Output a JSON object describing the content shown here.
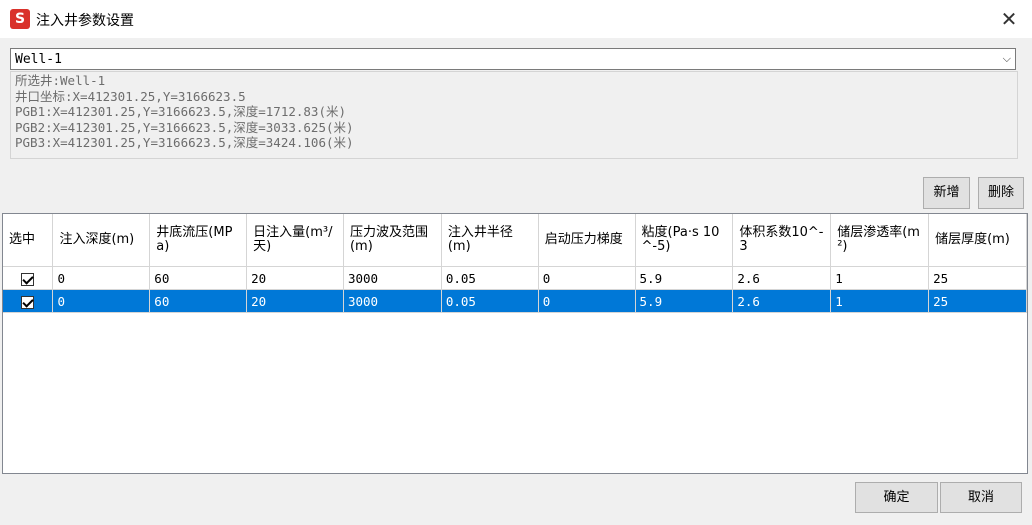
{
  "window": {
    "title": "注入井参数设置",
    "app_icon": "S",
    "close_glyph": "✕"
  },
  "well_select": {
    "value": "Well-1",
    "chevron_glyph": "⌵"
  },
  "info_lines": [
    "所选井:Well-1",
    "井口坐标:X=412301.25,Y=3166623.5",
    "PGB1:X=412301.25,Y=3166623.5,深度=1712.83(米)",
    "PGB2:X=412301.25,Y=3166623.5,深度=3033.625(米)",
    "PGB3:X=412301.25,Y=3166623.5,深度=3424.106(米)"
  ],
  "buttons": {
    "add": "新增",
    "delete": "删除",
    "ok": "确定",
    "cancel": "取消"
  },
  "table": {
    "headers": [
      "选中",
      "注入深度(m)",
      "井底流压(MPa)",
      "日注入量(m³/天)",
      "压力波及范围(m)",
      "注入井半径(m)",
      "启动压力梯度",
      "粘度(Pa·s 10^-5)",
      "体积系数10^-3",
      "储层渗透率(m²)",
      "储层厚度(m)"
    ],
    "rows": [
      {
        "checked": true,
        "cells": [
          "0",
          "60",
          "20",
          "3000",
          "0.05",
          "0",
          "5.9",
          "2.6",
          "1",
          "25"
        ]
      },
      {
        "checked": true,
        "cells": [
          "0",
          "60",
          "20",
          "3000",
          "0.05",
          "0",
          "5.9",
          "2.6",
          "1",
          "25"
        ]
      }
    ],
    "selected_row_color": "#0078d7"
  }
}
